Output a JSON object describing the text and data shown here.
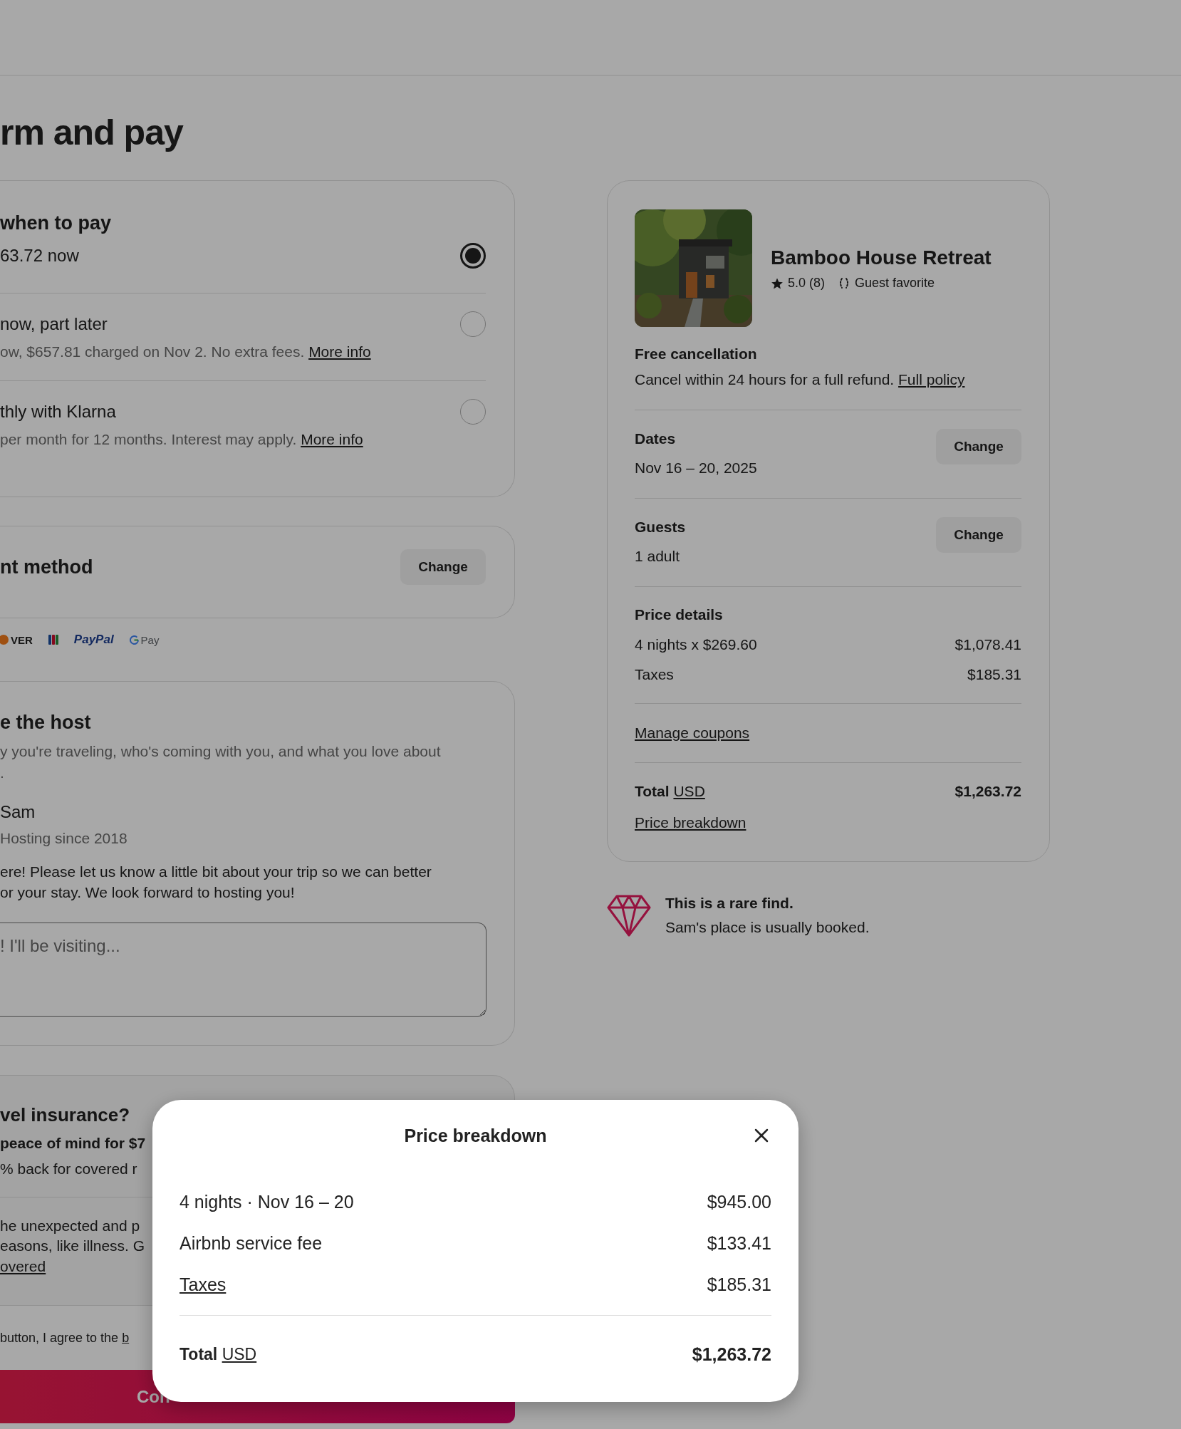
{
  "page_title": "rm and pay",
  "payment_timing": {
    "title": "when to pay",
    "options": [
      {
        "title": "63.72 now",
        "selected": true
      },
      {
        "title": "now, part later",
        "detail": "ow, $657.81 charged on Nov 2. No extra fees.",
        "link": "More info",
        "selected": false
      },
      {
        "title": "thly with Klarna",
        "detail": "per month for 12 months. Interest may apply.",
        "link": "More info",
        "selected": false
      }
    ]
  },
  "payment_method": {
    "title": "nt method",
    "button": "Change",
    "logos": [
      {
        "kind": "discover",
        "text": "VER"
      },
      {
        "kind": "jcb"
      },
      {
        "kind": "paypal",
        "text": "PayPal"
      },
      {
        "kind": "gpay",
        "text": "Pay"
      }
    ]
  },
  "message_host": {
    "title": "e the host",
    "subtitle_lines": [
      "y you're traveling, who's coming with you, and what you love about",
      "."
    ],
    "host_name": "Sam",
    "host_since": "Hosting since 2018",
    "message_lines": [
      "ere! Please let us know a little bit about your trip so we can better",
      "or your stay. We look forward to hosting you!"
    ],
    "placeholder": "! I'll be visiting..."
  },
  "insurance": {
    "title": "vel insurance?",
    "price_line": "peace of mind for $7",
    "refund_line": "% back for covered r",
    "description_lines": [
      "he unexpected and p",
      "easons, like illness. G"
    ],
    "link": "overed"
  },
  "agreement": {
    "text": "button, I agree to the",
    "link": "b"
  },
  "confirm_button": "Con",
  "listing": {
    "name": "Bamboo House Retreat",
    "rating": "5.0 (8)",
    "badge": "Guest favorite",
    "cancellation_title": "Free cancellation",
    "cancellation_text": "Cancel within 24 hours for a full refund.",
    "cancellation_link": "Full policy",
    "sections": [
      {
        "label": "Dates",
        "value": "Nov 16 – 20, 2025",
        "button": "Change"
      },
      {
        "label": "Guests",
        "value": "1 adult",
        "button": "Change"
      }
    ],
    "price_title": "Price details",
    "price_rows": [
      {
        "label": "4 nights x $269.60",
        "amount": "$1,078.41"
      },
      {
        "label": "Taxes",
        "amount": "$185.31"
      }
    ],
    "coupons_link": "Manage coupons",
    "total_label": "Total",
    "currency": "USD",
    "total": "$1,263.72",
    "breakdown_link": "Price breakdown"
  },
  "rare_find": {
    "title": "This is a rare find.",
    "text": "Sam's place is usually booked."
  },
  "modal": {
    "title": "Price breakdown",
    "rows": [
      {
        "label": "4 nights · Nov 16 – 20",
        "amount": "$945.00",
        "link": false
      },
      {
        "label": "Airbnb service fee",
        "amount": "$133.41",
        "link": false
      },
      {
        "label": "Taxes",
        "amount": "$185.31",
        "link": true
      }
    ],
    "total_label": "Total",
    "currency": "USD",
    "total": "$1,263.72"
  }
}
